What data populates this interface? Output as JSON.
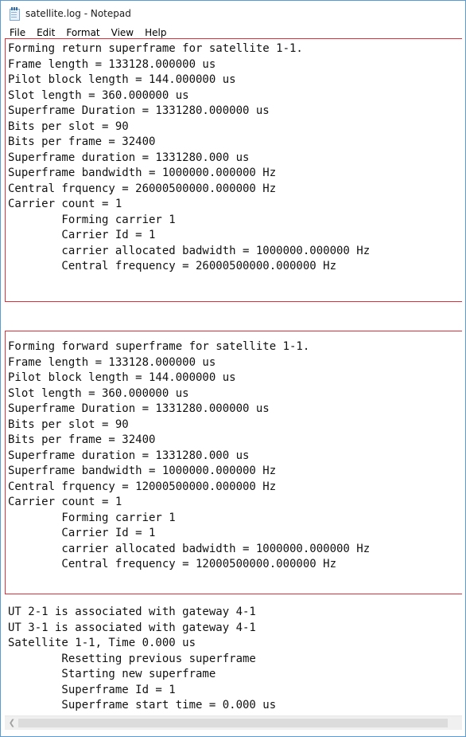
{
  "window": {
    "title": "satellite.log - Notepad"
  },
  "menu": [
    {
      "label": "File"
    },
    {
      "label": "Edit"
    },
    {
      "label": "Format"
    },
    {
      "label": "View"
    },
    {
      "label": "Help"
    }
  ],
  "colors": {
    "highlight_box": "#e0313b",
    "window_border": "#5b9bd5"
  },
  "log": {
    "return_block": "Forming return superframe for satellite 1-1.\nFrame length = 133128.000000 us\nPilot block length = 144.000000 us\nSlot length = 360.000000 us\nSuperframe Duration = 1331280.000000 us\nBits per slot = 90\nBits per frame = 32400\nSuperframe duration = 1331280.000 us\nSuperframe bandwidth = 1000000.000000 Hz\nCentral frquency = 26000500000.000000 Hz\nCarrier count = 1\n        Forming carrier 1\n        Carrier Id = 1\n        carrier allocated badwidth = 1000000.000000 Hz\n        Central frequency = 26000500000.000000 Hz",
    "forward_block": "Forming forward superframe for satellite 1-1.\nFrame length = 133128.000000 us\nPilot block length = 144.000000 us\nSlot length = 360.000000 us\nSuperframe Duration = 1331280.000000 us\nBits per slot = 90\nBits per frame = 32400\nSuperframe duration = 1331280.000 us\nSuperframe bandwidth = 1000000.000000 Hz\nCentral frquency = 12000500000.000000 Hz\nCarrier count = 1\n        Forming carrier 1\n        Carrier Id = 1\n        carrier allocated badwidth = 1000000.000000 Hz\n        Central frequency = 12000500000.000000 Hz",
    "tail_block": "UT 2-1 is associated with gateway 4-1\nUT 3-1 is associated with gateway 4-1\nSatellite 1-1, Time 0.000 us\n        Resetting previous superframe\n        Starting new superframe\n        Superframe Id = 1\n        Superframe start time = 0.000 us"
  },
  "scrollbar": {
    "left_arrow_icon": "chevron-left-icon"
  }
}
